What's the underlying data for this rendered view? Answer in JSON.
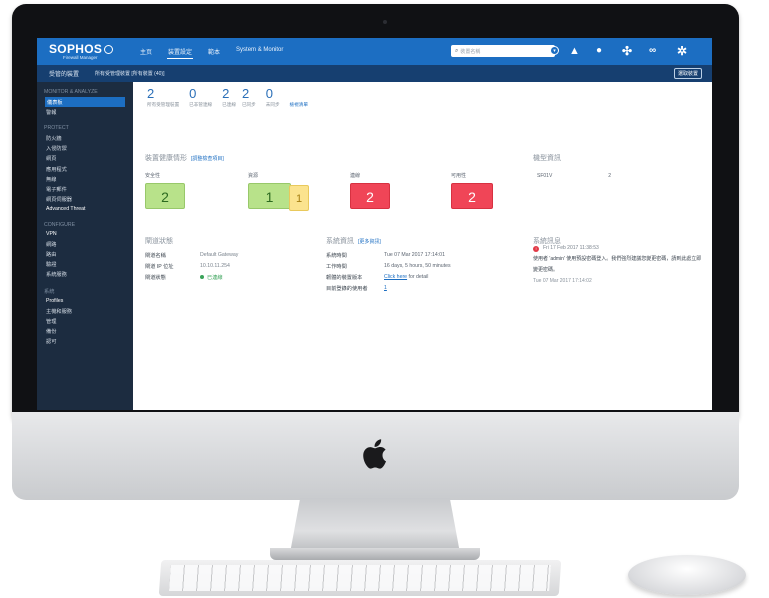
{
  "app": {
    "logo": "SOPHOS",
    "logo_sub": "Firewall Manager",
    "nav": [
      "主页",
      "装置設定",
      "範本",
      "System & Monitor"
    ],
    "search_placeholder": "裝置名稱",
    "top_icons": [
      "alert-icon",
      "info-icon",
      "network-icon",
      "binoculars-icon",
      "gear-icon"
    ]
  },
  "subbar": {
    "managed": "受管的裝置",
    "group": "所有受管理裝置 [所有裝置 (40)]",
    "button": "選取裝置"
  },
  "sidebar": {
    "sections": [
      {
        "title": "MONITOR & ANALYZE",
        "items": [
          "儀表板",
          "警報"
        ]
      },
      {
        "title": "PROTECT",
        "items": [
          "防火牆",
          "入侵防禦",
          "網頁",
          "應用程式",
          "無線",
          "電子郵件",
          "網頁伺服器",
          "Advanced Threat"
        ]
      },
      {
        "title": "CONFIGURE",
        "items": [
          "VPN",
          "網路",
          "路由",
          "驗證",
          "系統服務"
        ]
      },
      {
        "title": "系統",
        "items": [
          "Profiles",
          "主機和服務",
          "管理",
          "備份",
          "認可"
        ]
      }
    ],
    "active_item": "儀表板"
  },
  "stats": [
    {
      "num": "2",
      "label": "所有受管理裝置"
    },
    {
      "num": "0",
      "label": "已非管連線"
    },
    {
      "num": "2",
      "label": "已連線"
    },
    {
      "num": "2",
      "label": "已同步"
    },
    {
      "num": "0",
      "label": "未同步"
    }
  ],
  "stats_link": "檢視清單",
  "health": {
    "title": "裝置健康情形",
    "link": "[調整檢查項目]",
    "cards": [
      {
        "label": "安全性",
        "values": [
          "2"
        ],
        "status": [
          "green"
        ]
      },
      {
        "label": "資源",
        "values": [
          "1",
          "1"
        ],
        "status": [
          "green",
          "yellow"
        ]
      },
      {
        "label": "連線",
        "values": [
          "2"
        ],
        "status": [
          "red"
        ]
      },
      {
        "label": "可用性",
        "values": [
          "2"
        ],
        "status": [
          "red"
        ]
      }
    ]
  },
  "model": {
    "title": "機型資訊",
    "name": "SF01V",
    "count": "2"
  },
  "gateway": {
    "title": "閘道狀態",
    "rows": [
      {
        "k": "閘道名稱",
        "v": "Default Gateway"
      },
      {
        "k": "閘道 IP 位址",
        "v": "10.10.11.254"
      },
      {
        "k": "閘道狀態",
        "v": "已連線"
      }
    ]
  },
  "system": {
    "title": "系統資訊",
    "link": "[更多資訊]",
    "rows": [
      {
        "k": "系統時間",
        "v": "Tue 07 Mar 2017 17:14:01"
      },
      {
        "k": "工作時間",
        "v": "16 days, 5 hours, 50 minutes"
      },
      {
        "k": "韌體的裝置版本",
        "v": "Click here",
        "v2": " for detail"
      },
      {
        "k": "目前登錄的使用者",
        "v": "1"
      }
    ]
  },
  "messages": {
    "title": "系統訊息",
    "alert_date": "Fri 17 Feb 2017 11:38:53",
    "body": "使用者 'admin' 使用預設密碼登入。我們強烈建議您變更密碼，請到此處立即變更密碼。",
    "date2": "Tue 07 Mar 2017 17:14:02"
  },
  "colors": {
    "brand": "#1c6ec2",
    "sidebar": "#1c2c40",
    "green": "#b8e28a",
    "yellow": "#fbe38e",
    "red": "#f04557"
  }
}
